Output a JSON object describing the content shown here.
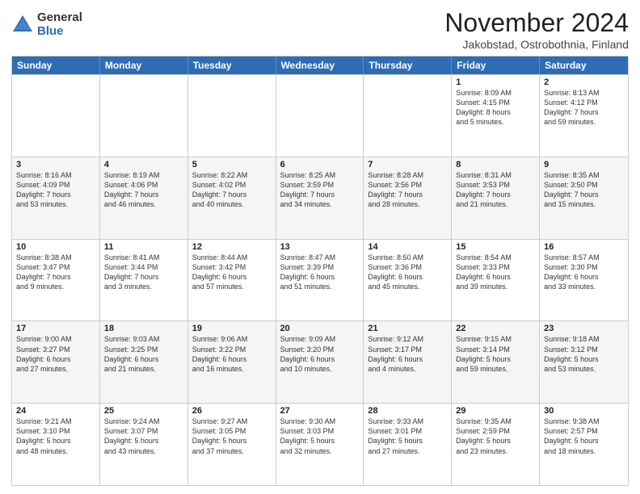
{
  "header": {
    "logo_general": "General",
    "logo_blue": "Blue",
    "month_title": "November 2024",
    "location": "Jakobstad, Ostrobothnia, Finland"
  },
  "weekdays": [
    "Sunday",
    "Monday",
    "Tuesday",
    "Wednesday",
    "Thursday",
    "Friday",
    "Saturday"
  ],
  "rows": [
    [
      {
        "day": "",
        "info": ""
      },
      {
        "day": "",
        "info": ""
      },
      {
        "day": "",
        "info": ""
      },
      {
        "day": "",
        "info": ""
      },
      {
        "day": "",
        "info": ""
      },
      {
        "day": "1",
        "info": "Sunrise: 8:09 AM\nSunset: 4:15 PM\nDaylight: 8 hours\nand 5 minutes."
      },
      {
        "day": "2",
        "info": "Sunrise: 8:13 AM\nSunset: 4:12 PM\nDaylight: 7 hours\nand 59 minutes."
      }
    ],
    [
      {
        "day": "3",
        "info": "Sunrise: 8:16 AM\nSunset: 4:09 PM\nDaylight: 7 hours\nand 53 minutes."
      },
      {
        "day": "4",
        "info": "Sunrise: 8:19 AM\nSunset: 4:06 PM\nDaylight: 7 hours\nand 46 minutes."
      },
      {
        "day": "5",
        "info": "Sunrise: 8:22 AM\nSunset: 4:02 PM\nDaylight: 7 hours\nand 40 minutes."
      },
      {
        "day": "6",
        "info": "Sunrise: 8:25 AM\nSunset: 3:59 PM\nDaylight: 7 hours\nand 34 minutes."
      },
      {
        "day": "7",
        "info": "Sunrise: 8:28 AM\nSunset: 3:56 PM\nDaylight: 7 hours\nand 28 minutes."
      },
      {
        "day": "8",
        "info": "Sunrise: 8:31 AM\nSunset: 3:53 PM\nDaylight: 7 hours\nand 21 minutes."
      },
      {
        "day": "9",
        "info": "Sunrise: 8:35 AM\nSunset: 3:50 PM\nDaylight: 7 hours\nand 15 minutes."
      }
    ],
    [
      {
        "day": "10",
        "info": "Sunrise: 8:38 AM\nSunset: 3:47 PM\nDaylight: 7 hours\nand 9 minutes."
      },
      {
        "day": "11",
        "info": "Sunrise: 8:41 AM\nSunset: 3:44 PM\nDaylight: 7 hours\nand 3 minutes."
      },
      {
        "day": "12",
        "info": "Sunrise: 8:44 AM\nSunset: 3:42 PM\nDaylight: 6 hours\nand 57 minutes."
      },
      {
        "day": "13",
        "info": "Sunrise: 8:47 AM\nSunset: 3:39 PM\nDaylight: 6 hours\nand 51 minutes."
      },
      {
        "day": "14",
        "info": "Sunrise: 8:50 AM\nSunset: 3:36 PM\nDaylight: 6 hours\nand 45 minutes."
      },
      {
        "day": "15",
        "info": "Sunrise: 8:54 AM\nSunset: 3:33 PM\nDaylight: 6 hours\nand 39 minutes."
      },
      {
        "day": "16",
        "info": "Sunrise: 8:57 AM\nSunset: 3:30 PM\nDaylight: 6 hours\nand 33 minutes."
      }
    ],
    [
      {
        "day": "17",
        "info": "Sunrise: 9:00 AM\nSunset: 3:27 PM\nDaylight: 6 hours\nand 27 minutes."
      },
      {
        "day": "18",
        "info": "Sunrise: 9:03 AM\nSunset: 3:25 PM\nDaylight: 6 hours\nand 21 minutes."
      },
      {
        "day": "19",
        "info": "Sunrise: 9:06 AM\nSunset: 3:22 PM\nDaylight: 6 hours\nand 16 minutes."
      },
      {
        "day": "20",
        "info": "Sunrise: 9:09 AM\nSunset: 3:20 PM\nDaylight: 6 hours\nand 10 minutes."
      },
      {
        "day": "21",
        "info": "Sunrise: 9:12 AM\nSunset: 3:17 PM\nDaylight: 6 hours\nand 4 minutes."
      },
      {
        "day": "22",
        "info": "Sunrise: 9:15 AM\nSunset: 3:14 PM\nDaylight: 5 hours\nand 59 minutes."
      },
      {
        "day": "23",
        "info": "Sunrise: 9:18 AM\nSunset: 3:12 PM\nDaylight: 5 hours\nand 53 minutes."
      }
    ],
    [
      {
        "day": "24",
        "info": "Sunrise: 9:21 AM\nSunset: 3:10 PM\nDaylight: 5 hours\nand 48 minutes."
      },
      {
        "day": "25",
        "info": "Sunrise: 9:24 AM\nSunset: 3:07 PM\nDaylight: 5 hours\nand 43 minutes."
      },
      {
        "day": "26",
        "info": "Sunrise: 9:27 AM\nSunset: 3:05 PM\nDaylight: 5 hours\nand 37 minutes."
      },
      {
        "day": "27",
        "info": "Sunrise: 9:30 AM\nSunset: 3:03 PM\nDaylight: 5 hours\nand 32 minutes."
      },
      {
        "day": "28",
        "info": "Sunrise: 9:33 AM\nSunset: 3:01 PM\nDaylight: 5 hours\nand 27 minutes."
      },
      {
        "day": "29",
        "info": "Sunrise: 9:35 AM\nSunset: 2:59 PM\nDaylight: 5 hours\nand 23 minutes."
      },
      {
        "day": "30",
        "info": "Sunrise: 9:38 AM\nSunset: 2:57 PM\nDaylight: 5 hours\nand 18 minutes."
      }
    ]
  ]
}
